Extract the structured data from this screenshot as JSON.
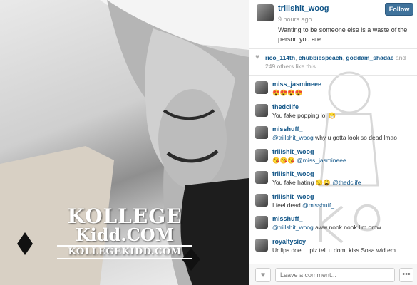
{
  "post": {
    "username": "trillshit_woog",
    "time": "9 hours ago",
    "caption": "Wanting to be someone else is a waste of the person you are....",
    "follow_label": "Follow"
  },
  "likes": {
    "names": [
      "rico_114th",
      "chubbiespeach",
      "goddam_shadae"
    ],
    "rest": "and 249 others like this."
  },
  "comments": [
    {
      "user": "miss_jasmineee",
      "text": "😍😍😍😍",
      "mention": ""
    },
    {
      "user": "thedclife",
      "text": "You fake popping lol 😁",
      "mention": ""
    },
    {
      "user": "misshuff_",
      "text": "why u gotta look so dead lmao",
      "mention": "@trillshit_woog"
    },
    {
      "user": "trillshit_woog",
      "text": "😘😘😘",
      "mention": "@miss_jasmineee",
      "order": "text-first"
    },
    {
      "user": "trillshit_woog",
      "text": "You fake hating 😒😩",
      "mention": "@thedclife",
      "order": "text-first"
    },
    {
      "user": "trillshit_woog",
      "text": "I feel dead",
      "mention": "@misshuff_",
      "order": "text-first"
    },
    {
      "user": "misshuff_",
      "text": "aww nook nook I'm omw",
      "mention": "@trillshit_woog"
    },
    {
      "user": "royaltysicy",
      "text": "Ur lips doe ... plz tell u domt kiss Sosa wid em",
      "mention": ""
    }
  ],
  "comment_box": {
    "placeholder": "Leave a comment..."
  },
  "watermark": {
    "line1": "KOLLEGE",
    "line2": "Kidd.COM",
    "line3": "KOLLEGEKIDD.COM"
  },
  "icons": {
    "heart": "heart-icon",
    "like_button": "heart-icon",
    "more": "ellipsis-icon"
  }
}
